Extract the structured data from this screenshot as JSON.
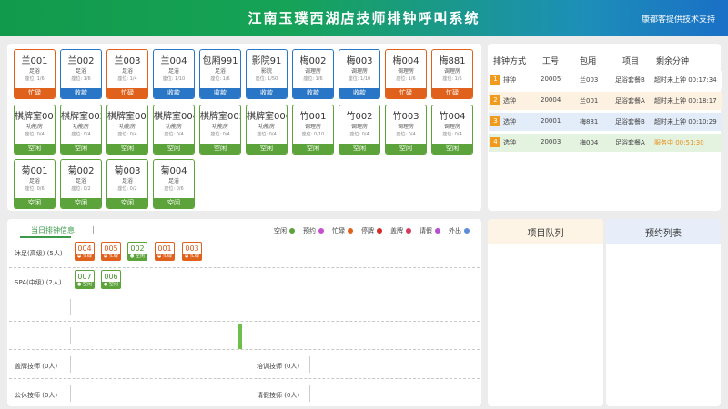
{
  "header": {
    "title": "江南玉璞西湖店技师排钟呼叫系统",
    "support": "康都客提供技术支持"
  },
  "rooms": [
    {
      "name": "兰001",
      "type": "足浴",
      "seat": "座位: 1/6",
      "status": "忙碌",
      "state": "busy"
    },
    {
      "name": "兰002",
      "type": "足浴",
      "seat": "座位: 1/6",
      "status": "收款",
      "state": "collect"
    },
    {
      "name": "兰003",
      "type": "足浴",
      "seat": "座位: 1/4",
      "status": "忙碌",
      "state": "busy"
    },
    {
      "name": "兰004",
      "type": "足浴",
      "seat": "座位: 1/10",
      "status": "收款",
      "state": "collect"
    },
    {
      "name": "包厢991",
      "type": "足浴",
      "seat": "座位: 1/6",
      "status": "收款",
      "state": "collect"
    },
    {
      "name": "影院91",
      "type": "影院",
      "seat": "座位: 1/50",
      "status": "收款",
      "state": "collect"
    },
    {
      "name": "梅002",
      "type": "调理房",
      "seat": "座位: 1/6",
      "status": "收款",
      "state": "collect"
    },
    {
      "name": "梅003",
      "type": "调理房",
      "seat": "座位: 1/10",
      "status": "收款",
      "state": "collect"
    },
    {
      "name": "梅004",
      "type": "调理房",
      "seat": "座位: 1/6",
      "status": "忙碌",
      "state": "busy"
    },
    {
      "name": "梅881",
      "type": "调理房",
      "seat": "座位: 1/6",
      "status": "忙碌",
      "state": "busy"
    },
    {
      "name": "棋牌室001",
      "type": "功能房",
      "seat": "座位: 0/4",
      "status": "空闲",
      "state": "free"
    },
    {
      "name": "棋牌室002",
      "type": "功能房",
      "seat": "座位: 0/4",
      "status": "空闲",
      "state": "free"
    },
    {
      "name": "棋牌室003",
      "type": "功能房",
      "seat": "座位: 0/4",
      "status": "空闲",
      "state": "free"
    },
    {
      "name": "棋牌室004",
      "type": "功能房",
      "seat": "座位: 0/4",
      "status": "空闲",
      "state": "free"
    },
    {
      "name": "棋牌室005",
      "type": "功能房",
      "seat": "座位: 0/4",
      "status": "空闲",
      "state": "free"
    },
    {
      "name": "棋牌室006",
      "type": "功能房",
      "seat": "座位: 0/4",
      "status": "空闲",
      "state": "free"
    },
    {
      "name": "竹001",
      "type": "调理房",
      "seat": "座位: 0/10",
      "status": "空闲",
      "state": "free"
    },
    {
      "name": "竹002",
      "type": "调理房",
      "seat": "座位: 0/4",
      "status": "空闲",
      "state": "free"
    },
    {
      "name": "竹003",
      "type": "调理房",
      "seat": "座位: 0/4",
      "status": "空闲",
      "state": "free"
    },
    {
      "name": "竹004",
      "type": "调理房",
      "seat": "座位: 0/4",
      "status": "空闲",
      "state": "free"
    },
    {
      "name": "菊001",
      "type": "足浴",
      "seat": "座位: 0/6",
      "status": "空闲",
      "state": "free"
    },
    {
      "name": "菊002",
      "type": "足浴",
      "seat": "座位: 0/2",
      "status": "空闲",
      "state": "free"
    },
    {
      "name": "菊003",
      "type": "足浴",
      "seat": "座位: 0/2",
      "status": "空闲",
      "state": "free"
    },
    {
      "name": "菊004",
      "type": "足浴",
      "seat": "座位: 0/6",
      "status": "空闲",
      "state": "free"
    }
  ],
  "queue": {
    "headers": [
      "排钟方式",
      "工号",
      "包厢",
      "项目",
      "剩余分钟"
    ],
    "rows": [
      {
        "num": "1",
        "mode": "排钟",
        "id": "20005",
        "room": "兰003",
        "item": "足浴套餐B",
        "status": "超时未上钟 00:17:34",
        "serving": false
      },
      {
        "num": "2",
        "mode": "选钟",
        "id": "20004",
        "room": "兰001",
        "item": "足浴套餐A",
        "status": "超时未上钟 00:18:17",
        "serving": false
      },
      {
        "num": "3",
        "mode": "选钟",
        "id": "20001",
        "room": "梅881",
        "item": "足浴套餐B",
        "status": "超时未上钟 00:10:29",
        "serving": false
      },
      {
        "num": "4",
        "mode": "选钟",
        "id": "20003",
        "room": "梅004",
        "item": "足浴套餐A",
        "status": "服务中 00:51:30",
        "serving": true
      }
    ]
  },
  "tabs": {
    "current": "当日排钟信息"
  },
  "legend": [
    {
      "label": "空闲",
      "color": "#5da33b"
    },
    {
      "label": "预约",
      "color": "#c94fd1"
    },
    {
      "label": "忙碌",
      "color": "#e0611b"
    },
    {
      "label": "停牌",
      "color": "#d62a2a"
    },
    {
      "label": "盖牌",
      "color": "#d63a5c"
    },
    {
      "label": "请假",
      "color": "#b74fd1"
    },
    {
      "label": "外出",
      "color": "#5b8ed6"
    }
  ],
  "techRows": {
    "foot": {
      "label": "沐足(高级) (5人)",
      "techs": [
        {
          "num": "004",
          "status": "◒ 忙碌",
          "state": "busy"
        },
        {
          "num": "005",
          "status": "◒ 忙碌",
          "state": "busy"
        },
        {
          "num": "002",
          "status": "● 空闲",
          "state": "idle"
        },
        {
          "num": "001",
          "status": "◒ 忙碌",
          "state": "busy"
        },
        {
          "num": "003",
          "status": "◒ 忙碌",
          "state": "busy"
        }
      ]
    },
    "spa": {
      "label": "SPA(中级) (2人)",
      "techs": [
        {
          "num": "007",
          "status": "● 空闲",
          "state": "idle"
        },
        {
          "num": "006",
          "status": "● 空闲",
          "state": "idle"
        }
      ]
    },
    "coverLabel": "盖牌技师 (0人)",
    "trainLabel": "培训技师 (0人)",
    "restLabel": "公休技师 (0人)",
    "leaveLabel": "请假技师 (0人)"
  },
  "sidePanels": {
    "projectQueue": "项目队列",
    "reservations": "预约列表"
  }
}
